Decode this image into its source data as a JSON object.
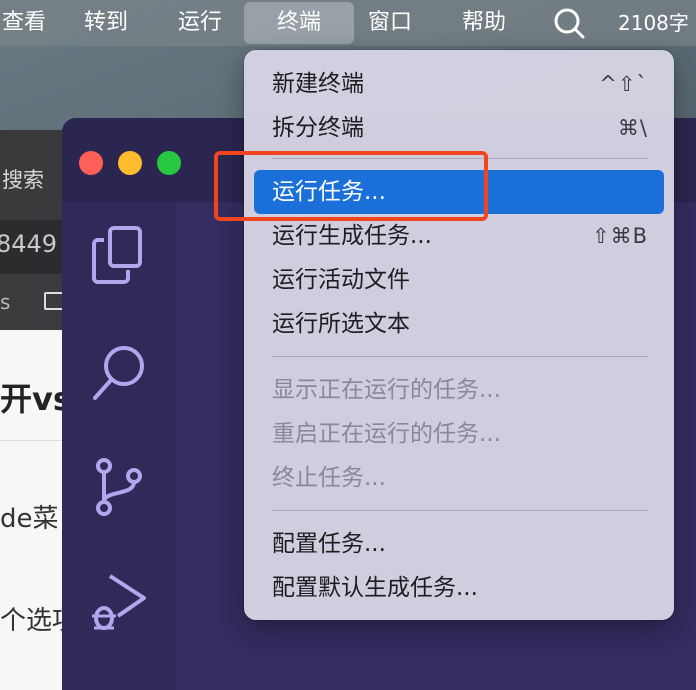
{
  "menubar": {
    "items": [
      "查看",
      "转到",
      "运行",
      "终端",
      "窗口",
      "帮助"
    ],
    "active_item": "终端",
    "search_icon": "spotlight-search-icon",
    "clock_text": "2108字"
  },
  "browser": {
    "search_label": "搜索",
    "url_fragment": "8449",
    "bookmark_fragment": "s",
    "heading_fragment": "开vs",
    "para1_fragment": "de菜",
    "para2_fragment": "个选项"
  },
  "vscode": {
    "traffic_lights": [
      "close",
      "minimize",
      "zoom"
    ],
    "activity_icons": [
      "explorer-icon",
      "search-icon",
      "source-control-icon",
      "run-debug-icon"
    ]
  },
  "terminal_menu": {
    "items": [
      {
        "label": "新建终端",
        "shortcut": "^⇧`",
        "enabled": true
      },
      {
        "label": "拆分终端",
        "shortcut": "⌘\\",
        "enabled": true
      },
      {
        "label": "运行任务...",
        "shortcut": "",
        "enabled": true,
        "highlighted": true
      },
      {
        "label": "运行生成任务...",
        "shortcut": "⇧⌘B",
        "enabled": true
      },
      {
        "label": "运行活动文件",
        "shortcut": "",
        "enabled": true
      },
      {
        "label": "运行所选文本",
        "shortcut": "",
        "enabled": true
      },
      {
        "label": "显示正在运行的任务...",
        "shortcut": "",
        "enabled": false
      },
      {
        "label": "重启正在运行的任务...",
        "shortcut": "",
        "enabled": false
      },
      {
        "label": "终止任务...",
        "shortcut": "",
        "enabled": false
      },
      {
        "label": "配置任务...",
        "shortcut": "",
        "enabled": true
      },
      {
        "label": "配置默认生成任务...",
        "shortcut": "",
        "enabled": true
      }
    ]
  },
  "colors": {
    "highlight": "#1a6fd9",
    "annotation": "#f0451f",
    "vscode_bg": "#2f2a57",
    "icon_stroke": "#b4a6ee"
  }
}
